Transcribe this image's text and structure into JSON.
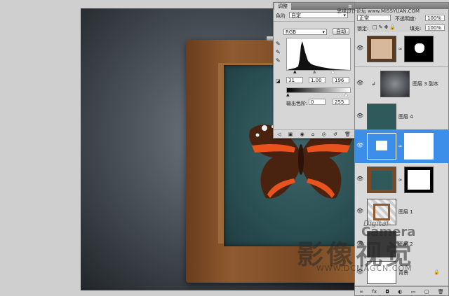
{
  "adjustments_panel": {
    "tab_label": "调整",
    "preset_label": "色阶",
    "preset_value": "自定",
    "channel_value": "RGB",
    "auto_label": "自动",
    "input_black": "31",
    "input_gamma": "1.00",
    "input_white": "196",
    "output_label": "输出色阶:",
    "output_black": "0",
    "output_white": "255"
  },
  "layers_panel": {
    "blend_mode": "正常",
    "opacity_label": "不透明度:",
    "opacity_value": "100%",
    "lock_label": "锁定:",
    "fill_label": "填充:",
    "fill_value": "100%",
    "layers": [
      {
        "name": ""
      },
      {
        "name": "图层 3 副本"
      },
      {
        "name": "图层 4"
      },
      {
        "name": ""
      },
      {
        "name": ""
      },
      {
        "name": "图层 1"
      },
      {
        "name": "图层 2"
      },
      {
        "name": "背景"
      }
    ]
  },
  "watermark": {
    "top_credit": "思缘设计论坛 www.MISSYUAN.COM",
    "digital": "Digital",
    "camera": "Camera",
    "chinese": "影像视觉",
    "url": "WWW.DCMAGCN.COM"
  },
  "colors": {
    "selection": "#3d8ee9",
    "slate": "#2c5256",
    "wood": "#8f5a30"
  }
}
